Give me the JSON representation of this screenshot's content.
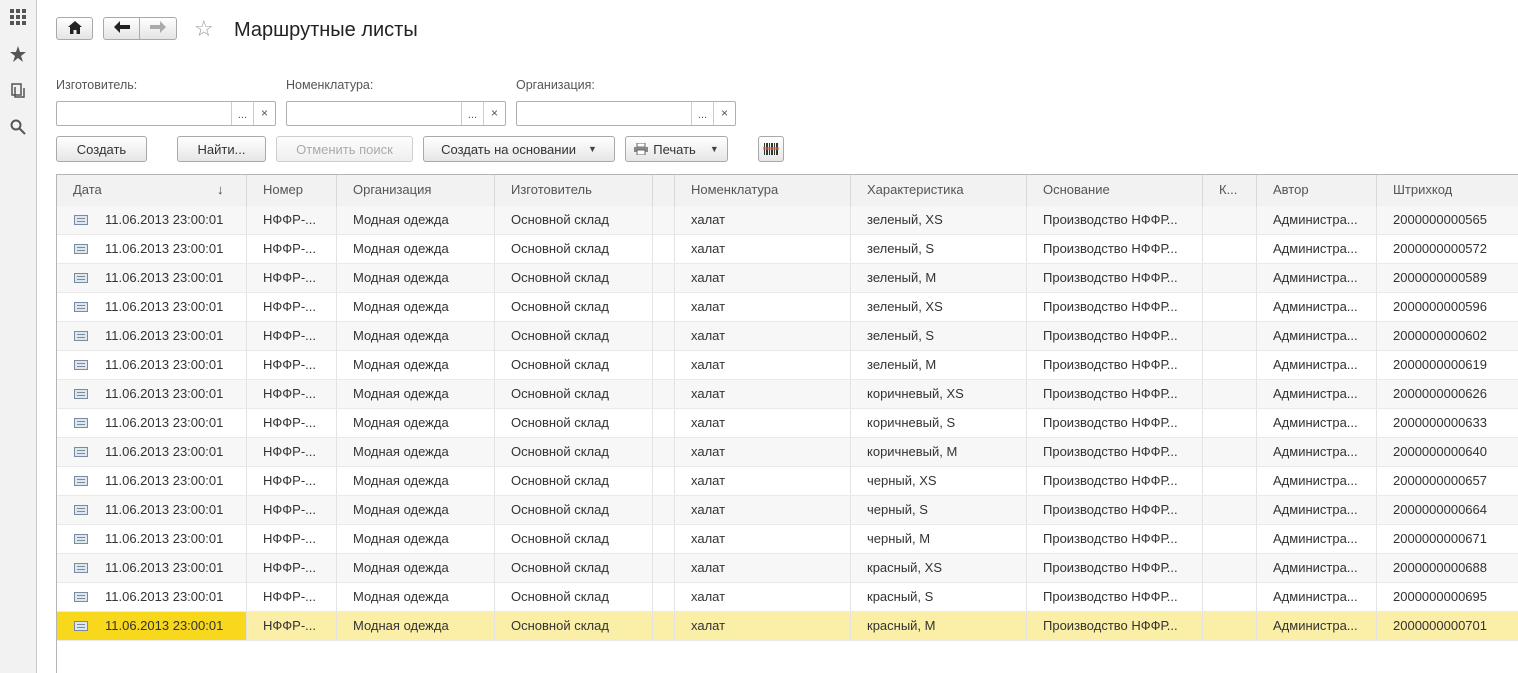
{
  "title": "Маршрутные листы",
  "filters": [
    {
      "label": "Изготовитель:",
      "value": "",
      "select": "...",
      "clear": "×"
    },
    {
      "label": "Номенклатура:",
      "value": "",
      "select": "...",
      "clear": "×"
    },
    {
      "label": "Организация:",
      "value": "",
      "select": "...",
      "clear": "×"
    }
  ],
  "buttons": {
    "create": "Создать",
    "find": "Найти...",
    "cancel_search": "Отменить поиск",
    "create_based": "Создать на основании",
    "print": "Печать"
  },
  "table": {
    "columns": [
      "Дата",
      "Номер",
      "Организация",
      "Изготовитель",
      "",
      "Номенклатура",
      "Характеристика",
      "Основание",
      "К...",
      "Автор",
      "Штрихкод"
    ],
    "sort_indicator": "↓",
    "rows": [
      [
        "11.06.2013 23:00:01",
        "НФФР-...",
        "Модная одежда",
        "Основной склад",
        "",
        "халат",
        "зеленый, XS",
        "Производство НФФР...",
        "",
        "Администра...",
        "2000000000565"
      ],
      [
        "11.06.2013 23:00:01",
        "НФФР-...",
        "Модная одежда",
        "Основной склад",
        "",
        "халат",
        "зеленый, S",
        "Производство НФФР...",
        "",
        "Администра...",
        "2000000000572"
      ],
      [
        "11.06.2013 23:00:01",
        "НФФР-...",
        "Модная одежда",
        "Основной склад",
        "",
        "халат",
        "зеленый, M",
        "Производство НФФР...",
        "",
        "Администра...",
        "2000000000589"
      ],
      [
        "11.06.2013 23:00:01",
        "НФФР-...",
        "Модная одежда",
        "Основной склад",
        "",
        "халат",
        "зеленый, XS",
        "Производство НФФР...",
        "",
        "Администра...",
        "2000000000596"
      ],
      [
        "11.06.2013 23:00:01",
        "НФФР-...",
        "Модная одежда",
        "Основной склад",
        "",
        "халат",
        "зеленый, S",
        "Производство НФФР...",
        "",
        "Администра...",
        "2000000000602"
      ],
      [
        "11.06.2013 23:00:01",
        "НФФР-...",
        "Модная одежда",
        "Основной склад",
        "",
        "халат",
        "зеленый, M",
        "Производство НФФР...",
        "",
        "Администра...",
        "2000000000619"
      ],
      [
        "11.06.2013 23:00:01",
        "НФФР-...",
        "Модная одежда",
        "Основной склад",
        "",
        "халат",
        "коричневый, XS",
        "Производство НФФР...",
        "",
        "Администра...",
        "2000000000626"
      ],
      [
        "11.06.2013 23:00:01",
        "НФФР-...",
        "Модная одежда",
        "Основной склад",
        "",
        "халат",
        "коричневый, S",
        "Производство НФФР...",
        "",
        "Администра...",
        "2000000000633"
      ],
      [
        "11.06.2013 23:00:01",
        "НФФР-...",
        "Модная одежда",
        "Основной склад",
        "",
        "халат",
        "коричневый, M",
        "Производство НФФР...",
        "",
        "Администра...",
        "2000000000640"
      ],
      [
        "11.06.2013 23:00:01",
        "НФФР-...",
        "Модная одежда",
        "Основной склад",
        "",
        "халат",
        "черный, XS",
        "Производство НФФР...",
        "",
        "Администра...",
        "2000000000657"
      ],
      [
        "11.06.2013 23:00:01",
        "НФФР-...",
        "Модная одежда",
        "Основной склад",
        "",
        "халат",
        "черный, S",
        "Производство НФФР...",
        "",
        "Администра...",
        "2000000000664"
      ],
      [
        "11.06.2013 23:00:01",
        "НФФР-...",
        "Модная одежда",
        "Основной склад",
        "",
        "халат",
        "черный, M",
        "Производство НФФР...",
        "",
        "Администра...",
        "2000000000671"
      ],
      [
        "11.06.2013 23:00:01",
        "НФФР-...",
        "Модная одежда",
        "Основной склад",
        "",
        "халат",
        "красный, XS",
        "Производство НФФР...",
        "",
        "Администра...",
        "2000000000688"
      ],
      [
        "11.06.2013 23:00:01",
        "НФФР-...",
        "Модная одежда",
        "Основной склад",
        "",
        "халат",
        "красный, S",
        "Производство НФФР...",
        "",
        "Администра...",
        "2000000000695"
      ],
      [
        "11.06.2013 23:00:01",
        "НФФР-...",
        "Модная одежда",
        "Основной склад",
        "",
        "халат",
        "красный, M",
        "Производство НФФР...",
        "",
        "Администра...",
        "2000000000701"
      ]
    ],
    "selected_row": 14
  },
  "icons": {
    "sidebar": [
      "apps-grid-icon",
      "favorites-star-icon",
      "history-icon",
      "search-icon"
    ],
    "toolbar": [
      "home-icon",
      "back-arrow-icon",
      "forward-arrow-icon",
      "favorite-star-icon"
    ],
    "row": "document-icon",
    "barcode": "barcode-icon",
    "printer": "printer-icon"
  },
  "colors": {
    "selected_row": "#fbeea6",
    "selected_cell": "#f7d81c",
    "header_bg": "#f2f2f2"
  }
}
